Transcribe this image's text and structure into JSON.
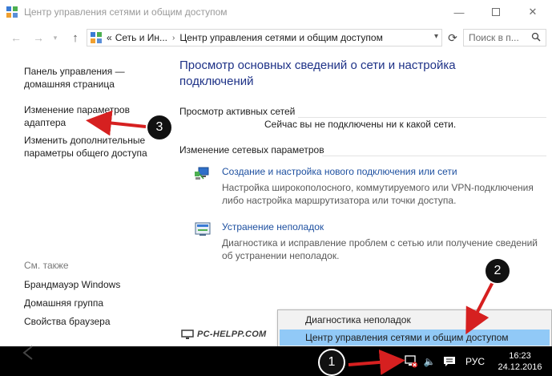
{
  "window": {
    "title": "Центр управления сетями и общим доступом",
    "min_icon": "minimize-icon",
    "max_icon": "maximize-icon",
    "close_icon": "close-icon"
  },
  "navbar": {
    "back_icon": "arrow-left-icon",
    "forward_icon": "arrow-right-icon",
    "up_icon": "arrow-up-icon",
    "address_prefix": "«",
    "breadcrumb_1": "Сеть и Ин...",
    "breadcrumb_2": "Центр управления сетями и общим доступом",
    "refresh_icon": "refresh-icon",
    "search_placeholder": "Поиск в п..."
  },
  "left_pane": {
    "home_link_1": "Панель управления —",
    "home_link_2": "домашняя страница",
    "adapter_link_1": "Изменение параметров",
    "adapter_link_2": "адаптера",
    "sharing_link_1": "Изменить дополнительные",
    "sharing_link_2": "параметры общего доступа",
    "see_also": "См. также",
    "firewall": "Брандмауэр Windows",
    "homegroup": "Домашняя группа",
    "browser": "Свойства браузера"
  },
  "main": {
    "title_1": "Просмотр основных сведений о сети и настройка",
    "title_2": "подключений",
    "active_networks": "Просмотр активных сетей",
    "not_connected": "Сейчас вы не подключены ни к какой сети.",
    "change_settings": "Изменение сетевых параметров",
    "task1_link": "Создание и настройка нового подключения или сети",
    "task1_desc_1": "Настройка широкополосного, коммутируемого или VPN-подключения",
    "task1_desc_2": "либо настройка маршрутизатора или точки доступа.",
    "task2_link": "Устранение неполадок",
    "task2_desc_1": "Диагностика и исправление проблем с сетью или получение сведений",
    "task2_desc_2": "об устранении неполадок."
  },
  "context_menu": {
    "item_1": "Диагностика неполадок",
    "item_2": "Центр управления сетями и общим доступом"
  },
  "watermark": "PC-HELPP.COM",
  "taskbar": {
    "lang": "РУС",
    "time": "16:23",
    "date": "24.12.2016"
  },
  "annotations": {
    "badge_1": "1",
    "badge_2": "2",
    "badge_3": "3",
    "arrow_color": "#d62020"
  },
  "colors": {
    "title_blue": "#1e3287",
    "link_blue": "#1e50a0",
    "menu_highlight": "#91c9f7"
  }
}
